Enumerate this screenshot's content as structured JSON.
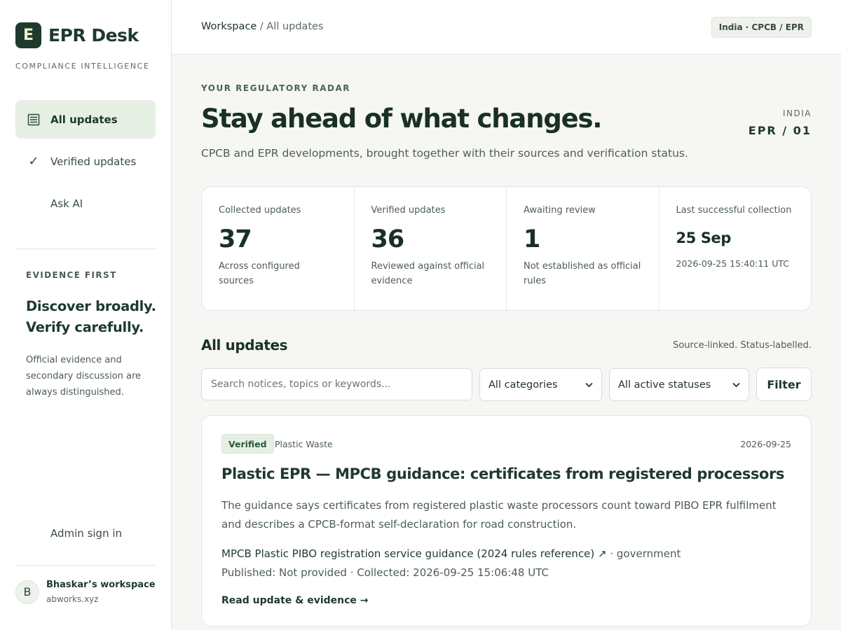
{
  "brand": {
    "mark": "E",
    "name": "EPR Desk",
    "tagline": "COMPLIANCE INTELLIGENCE"
  },
  "nav": {
    "items": [
      {
        "label": "All updates",
        "icon": "list-icon",
        "active": true
      },
      {
        "label": "Verified updates",
        "icon": "check-icon",
        "active": false
      },
      {
        "label": "Ask AI",
        "icon": "",
        "active": false
      }
    ]
  },
  "evidence": {
    "kicker": "EVIDENCE FIRST",
    "title": "Discover broadly. Verify carefully.",
    "description": "Official evidence and secondary discussion are always distinguished."
  },
  "admin_label": "Admin sign in",
  "user": {
    "initial": "B",
    "name": "Bhaskar’s workspace",
    "domain": "abworks.xyz"
  },
  "topbar": {
    "breadcrumb_root": "Workspace",
    "breadcrumb_separator": " / ",
    "breadcrumb_current": "All updates",
    "region_pill": "India · CPCB / EPR"
  },
  "hero": {
    "kicker": "YOUR REGULATORY RADAR",
    "headline": "Stay ahead of what changes.",
    "subtitle": "CPCB and EPR developments, brought together with their sources and verification status.",
    "region_country": "INDIA",
    "region_code": "EPR / 01"
  },
  "stats": [
    {
      "label": "Collected updates",
      "value": "37",
      "note": "Across configured sources"
    },
    {
      "label": "Verified updates",
      "value": "36",
      "note": "Reviewed against official evidence"
    },
    {
      "label": "Awaiting review",
      "value": "1",
      "note": "Not established as official rules"
    },
    {
      "label": "Last successful collection",
      "value": "25 Sep",
      "note": "2026-09-25 15:40:11 UTC"
    }
  ],
  "updates_section": {
    "title": "All updates",
    "note": "Source-linked. Status-labelled.",
    "search_placeholder": "Search notices, topics or keywords...",
    "category_select": "All categories",
    "status_select": "All active statuses",
    "filter_label": "Filter"
  },
  "update": {
    "status": "Verified",
    "category": "Plastic Waste",
    "date": "2026-09-25",
    "title": "Plastic EPR — MPCB guidance: certificates from registered processors",
    "summary": "The guidance says certificates from registered plastic waste processors count toward PIBO EPR fulfilment and describes a CPCB-format self-declaration for road construction.",
    "source_link": "MPCB Plastic PIBO registration service guidance (2024 rules reference) ↗",
    "source_type": " · government",
    "meta": "Published: Not provided · Collected: 2026-09-25 15:06:48 UTC",
    "read_more": "Read update & evidence →"
  },
  "colors": {
    "brand": "#1e3a2c",
    "accent_bg": "#e6efe3",
    "page_bg": "#f6f7f4"
  }
}
